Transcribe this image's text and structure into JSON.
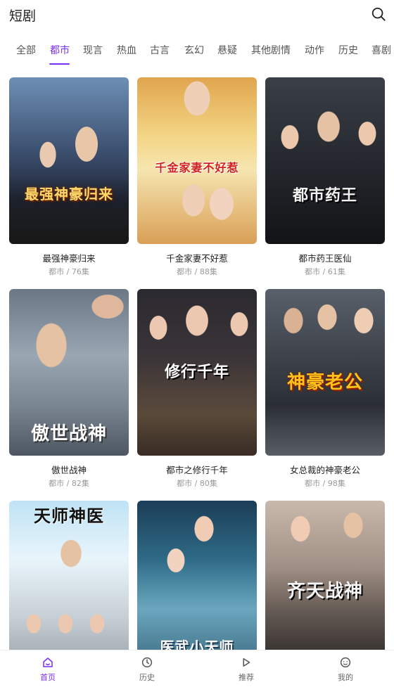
{
  "header": {
    "title": "短剧"
  },
  "tabs": [
    "全部",
    "都市",
    "现言",
    "热血",
    "古言",
    "玄幻",
    "悬疑",
    "其他剧情",
    "动作",
    "历史",
    "喜剧"
  ],
  "active_tab": "都市",
  "dramas": [
    {
      "title": "最强神豪归来",
      "meta": "都市 / 76集",
      "art_title": "最强神豪归来"
    },
    {
      "title": "千金家妻不好惹",
      "meta": "都市 / 88集",
      "art_title": "千金家妻不好惹"
    },
    {
      "title": "都市药王医仙",
      "meta": "都市 / 61集",
      "art_title": "都市药王"
    },
    {
      "title": "傲世战神",
      "meta": "都市 / 82集",
      "art_title": "傲世战神"
    },
    {
      "title": "都市之修行千年",
      "meta": "都市 / 80集",
      "art_title": "修行千年"
    },
    {
      "title": "女总裁的神豪老公",
      "meta": "都市 / 98集",
      "art_title": "神豪老公"
    },
    {
      "title": "",
      "meta": "",
      "art_title": "天师神医"
    },
    {
      "title": "",
      "meta": "",
      "art_title": "医武小天师"
    },
    {
      "title": "",
      "meta": "",
      "art_title": "齐天战神"
    }
  ],
  "bottom_nav": [
    {
      "label": "首页",
      "icon": "home-icon",
      "active": true
    },
    {
      "label": "历史",
      "icon": "history-icon",
      "active": false
    },
    {
      "label": "推荐",
      "icon": "play-icon",
      "active": false
    },
    {
      "label": "我的",
      "icon": "profile-icon",
      "active": false
    }
  ],
  "colors": {
    "accent": "#7b2ff2",
    "text": "#222222",
    "muted": "#999999"
  }
}
